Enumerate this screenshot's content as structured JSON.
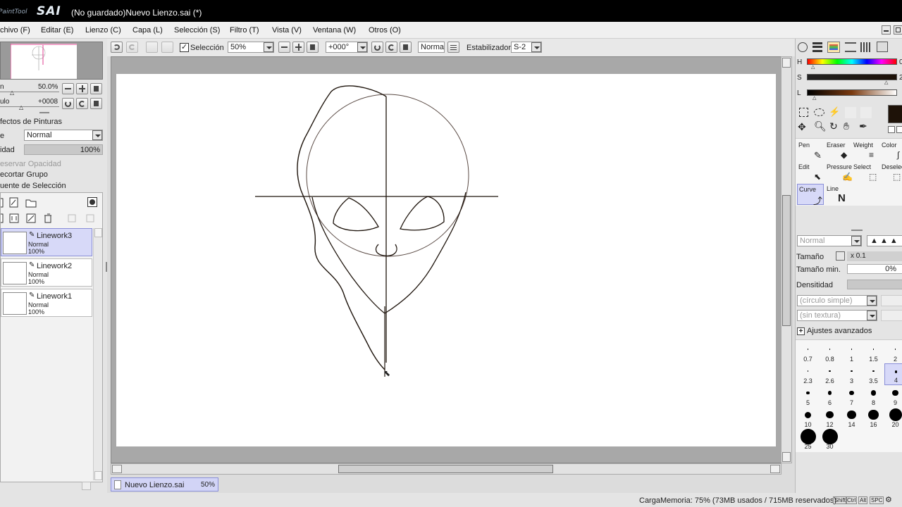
{
  "window": {
    "title": "(No guardado)Nuevo Lienzo.sai (*)",
    "logo_prefix": "PaintTool",
    "logo_text": "SAI"
  },
  "menu": [
    {
      "id": "archivo",
      "label": "chivo (F)"
    },
    {
      "id": "editar",
      "label": "Editar (E)"
    },
    {
      "id": "lienzo",
      "label": "Lienzo (C)"
    },
    {
      "id": "capa",
      "label": "Capa (L)"
    },
    {
      "id": "seleccion",
      "label": "Selección (S)"
    },
    {
      "id": "filtro",
      "label": "Filtro (T)"
    },
    {
      "id": "vista",
      "label": "Vista (V)"
    },
    {
      "id": "ventana",
      "label": "Ventana (W)"
    },
    {
      "id": "otros",
      "label": "Otros (O)"
    }
  ],
  "navigator": {
    "zoom_label": "n",
    "zoom_value": "50.0%",
    "angle_label": "ulo",
    "angle_value": "+0008"
  },
  "layer_props": {
    "effects_label": "fectos de Pinturas",
    "mode_label": "e",
    "mode_value": "Normal",
    "opacity_label": "idad",
    "opacity_value": "100%",
    "opacity_fraction": 1.0,
    "preserve_opacity": "eservar Opacidad",
    "clip_group": "ecortar Grupo",
    "selection_source": "uente de Selección"
  },
  "layers": [
    {
      "name": "Linework3",
      "mode": "Normal",
      "opacity": "100%",
      "selected": true
    },
    {
      "name": "Linework2",
      "mode": "Normal",
      "opacity": "100%",
      "selected": false
    },
    {
      "name": "Linework1",
      "mode": "Normal",
      "opacity": "100%",
      "selected": false
    }
  ],
  "toolbar": {
    "selection_label": "Selección",
    "selection_checked": true,
    "zoom": "50%",
    "rotation": "+000°",
    "blend": "Normal",
    "stabilizer_label": "Estabilizador",
    "stabilizer_value": "S-2"
  },
  "color": {
    "h_label": "H",
    "s_label": "S",
    "l_label": "L",
    "h_value": "0",
    "s_value": "2",
    "l_value": "",
    "current_color": "#1e1208"
  },
  "tools": [
    {
      "id": "pen",
      "label": "Pen"
    },
    {
      "id": "eraser",
      "label": "Eraser"
    },
    {
      "id": "weight",
      "label": "Weight"
    },
    {
      "id": "color",
      "label": "Color"
    },
    {
      "id": "edit",
      "label": "Edit"
    },
    {
      "id": "pressure",
      "label": "Pressure"
    },
    {
      "id": "select",
      "label": "Select"
    },
    {
      "id": "deselect",
      "label": "Deselec"
    },
    {
      "id": "curve",
      "label": "Curve"
    },
    {
      "id": "line",
      "label": "Line"
    }
  ],
  "brush": {
    "mode": "Normal",
    "size_label": "Tamaño",
    "size_mult": "x 0.1",
    "min_size_label": "Tamaño min.",
    "min_size_value": "0%",
    "density_label": "Densitidad",
    "shape": "(círculo simple)",
    "texture": "(sin textura)",
    "advanced_label": "Ajustes avanzados"
  },
  "brush_sizes": [
    "0.7",
    "0.8",
    "1",
    "1.5",
    "2",
    "2.3",
    "2.6",
    "3",
    "3.5",
    "4",
    "5",
    "6",
    "7",
    "8",
    "9",
    "10",
    "12",
    "14",
    "16",
    "20",
    "25",
    "30"
  ],
  "selected_brush_size": "4",
  "document_tab": {
    "name": "Nuevo Lienzo.sai",
    "zoom": "50%"
  },
  "status": {
    "memory": "CargaMemoria: 75% (73MB usados / 715MB reservados)",
    "keys": [
      "Shift",
      "Ctrl",
      "Alt",
      "SPC"
    ]
  }
}
